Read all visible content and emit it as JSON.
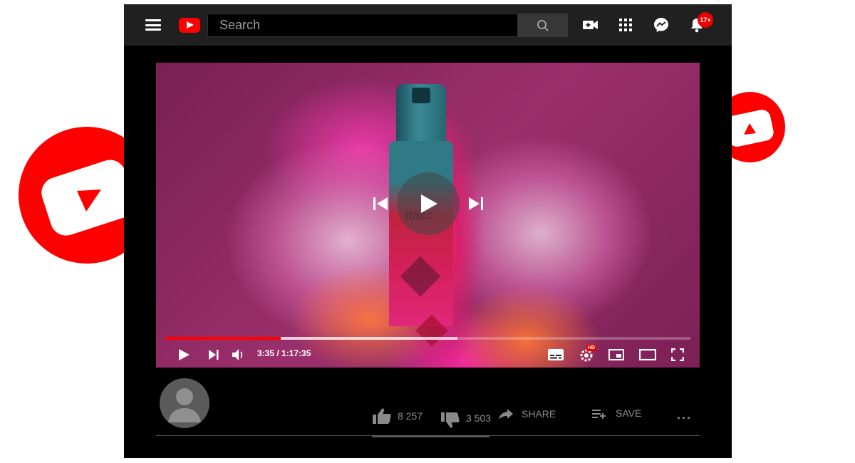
{
  "header": {
    "search": {
      "placeholder": "Search",
      "value": ""
    },
    "notifications_badge": "17+",
    "icons": [
      "menu-icon",
      "logo-icon",
      "search-icon",
      "video-camera-icon",
      "apps-grid-icon",
      "messenger-icon",
      "bell-icon"
    ]
  },
  "player": {
    "time": "3:35 / 1:17:35",
    "progress_played": 0.22,
    "progress_buffered": 0.556,
    "hd_label": "HD",
    "bottle_text": "ltacc"
  },
  "actions": {
    "likes": "8 257",
    "dislikes": "3 503",
    "share_label": "SHARE",
    "save_label": "SAVE",
    "more_label": "..."
  },
  "colors": {
    "accent": "#ff0000",
    "topbar": "#202020",
    "background": "#000000"
  }
}
